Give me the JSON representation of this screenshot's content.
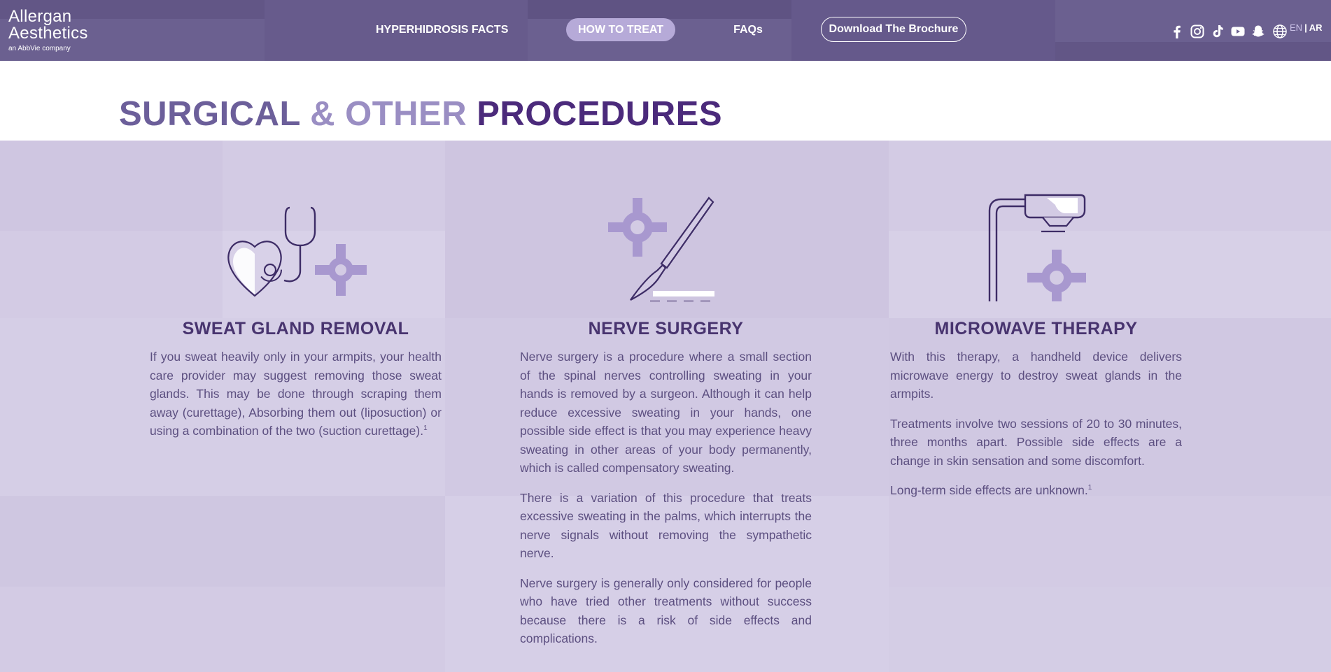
{
  "header": {
    "logo_line1": "Allergan",
    "logo_line2": "Aesthetics",
    "logo_line3": "an AbbVie company",
    "nav": {
      "facts": "HYPERHIDROSIS FACTS",
      "how_to_treat": "HOW TO TREAT",
      "faqs": "FAQs",
      "brochure": "Download The Brochure"
    },
    "social_icons": [
      "facebook-icon",
      "instagram-icon",
      "tiktok-icon",
      "youtube-icon",
      "snapchat-icon"
    ],
    "lang": {
      "en": "EN",
      "sep": "|",
      "ar": "AR"
    }
  },
  "page_title": {
    "part1": "SURGICAL",
    "part2": " & OTHER ",
    "part3": "PROCEDURES"
  },
  "columns": [
    {
      "icon": "heart-stethoscope-icon",
      "title": "SWEAT GLAND REMOVAL",
      "paragraphs": [
        "If you sweat heavily only in your armpits, your health care provider may suggest removing those sweat glands. This may be done through scraping them away (curettage), Absorbing them out (liposuction) or using a combination of the two (suction curettage)."
      ],
      "footnote": "1"
    },
    {
      "icon": "scalpel-icon",
      "title": "NERVE SURGERY",
      "paragraphs": [
        "Nerve surgery is a procedure where a small section of the spinal nerves controlling sweating in your hands is removed by a surgeon. Although it can help reduce excessive sweating in your hands, one possible side effect is that you may experience heavy sweating in other areas of your body permanently, which is called compensatory sweating.",
        "There is a variation of this procedure that treats excessive sweating in the palms, which interrupts the nerve signals without removing the sympathetic nerve.",
        "Nerve surgery is generally only considered for people who have tried other treatments without success because there is a risk of side effects and complications."
      ]
    },
    {
      "icon": "microwave-device-icon",
      "title": "MICROWAVE THERAPY",
      "paragraphs": [
        "With this therapy, a handheld device delivers microwave energy to destroy sweat glands in the armpits.",
        "Treatments involve two sessions of 20 to 30 minutes, three months apart. Possible side effects are a change in skin sensation and some discomfort.",
        "Long-term side effects are unknown."
      ],
      "footnote": "1"
    }
  ],
  "colors": {
    "header_bg": "#6b6090",
    "content_bg": "#d3cbe4",
    "title_dark": "#4b2a7b",
    "accent_light": "#9a8ec3"
  }
}
